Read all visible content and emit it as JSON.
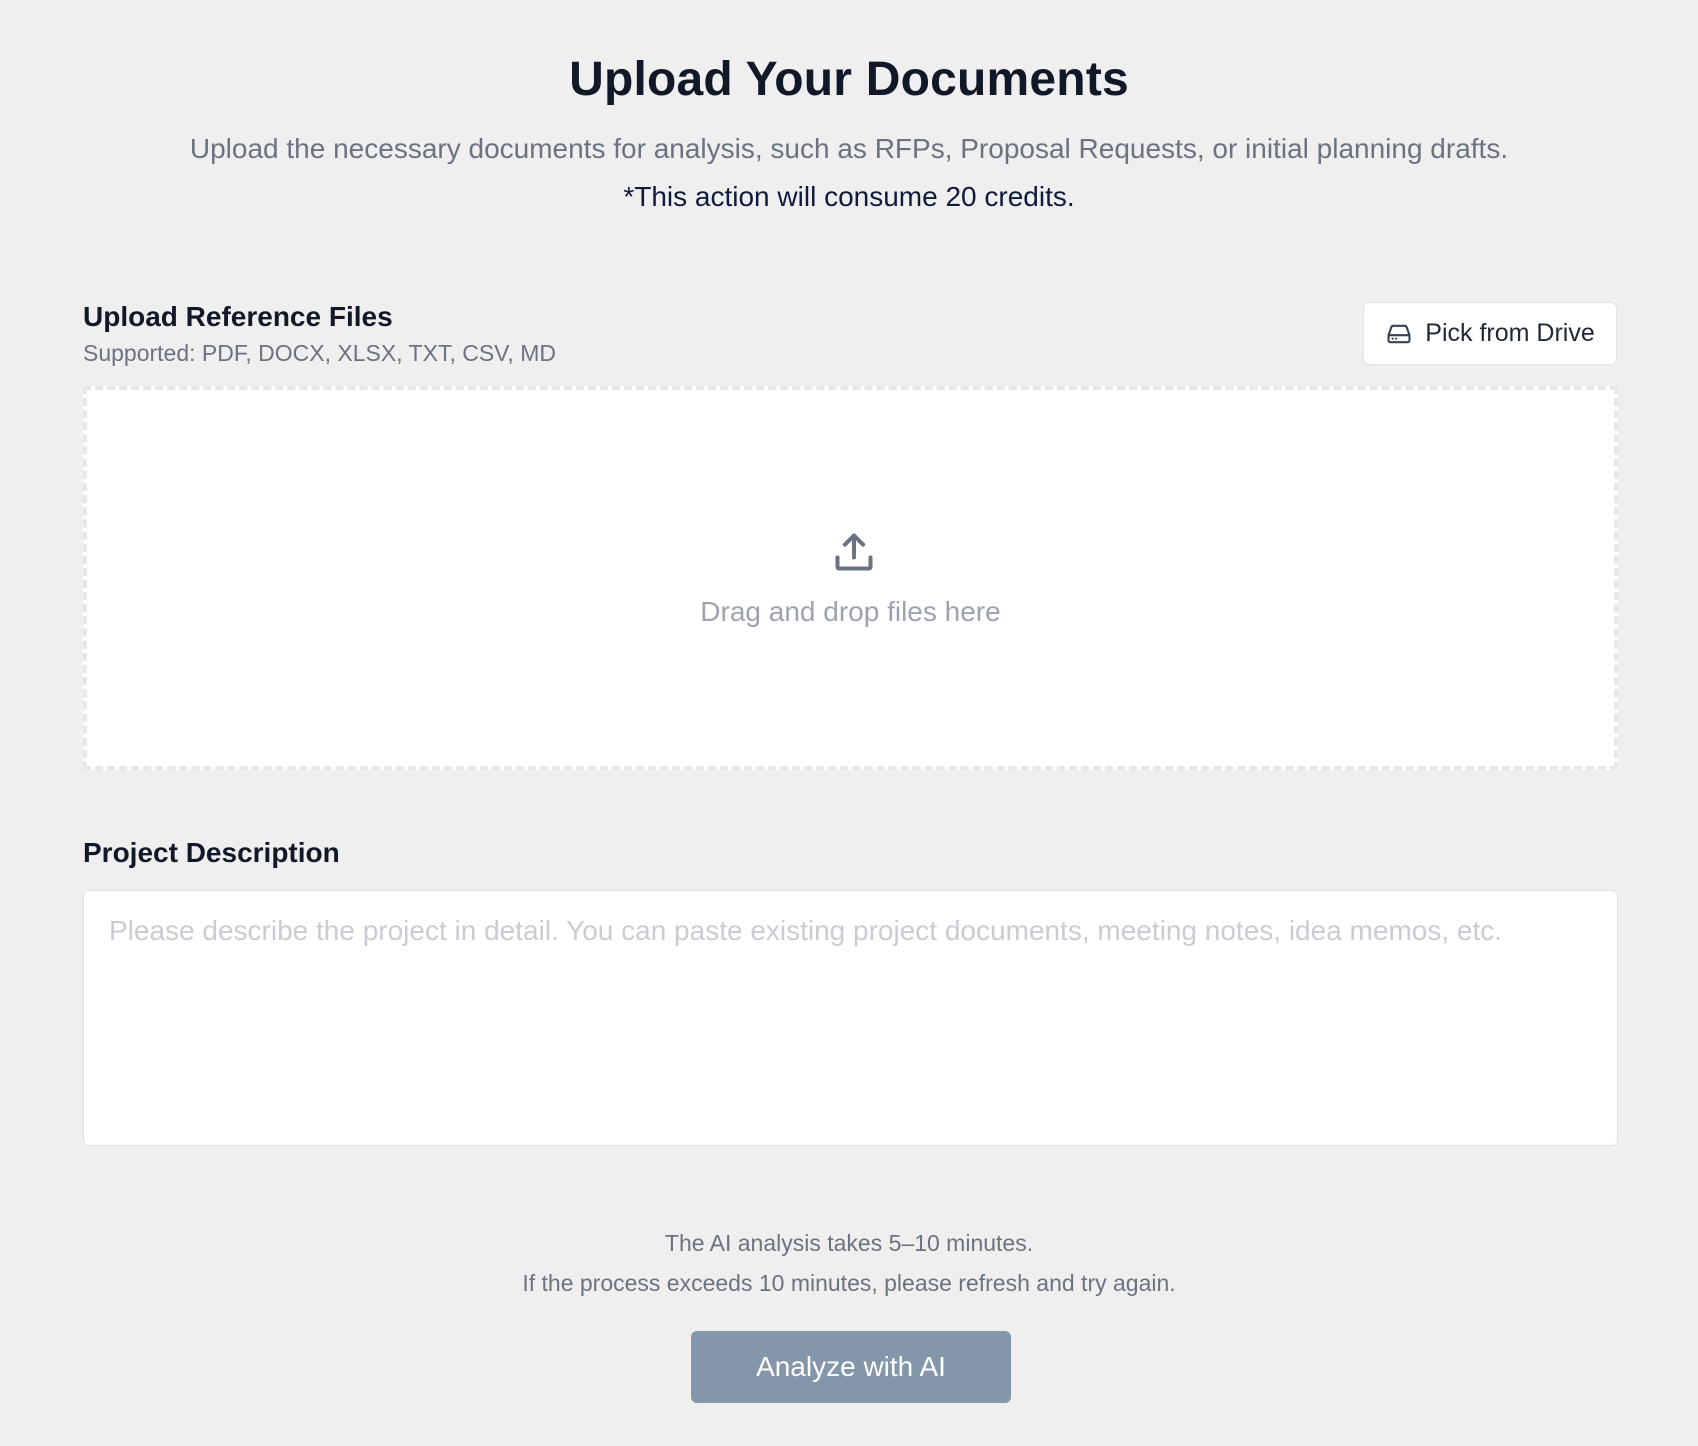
{
  "header": {
    "title": "Upload Your Documents",
    "subtitle": "Upload the necessary documents for analysis, such as RFPs, Proposal Requests, or initial planning drafts.",
    "credits_note": "*This action will consume 20 credits."
  },
  "upload": {
    "label": "Upload Reference Files",
    "supported": "Supported: PDF, DOCX, XLSX, TXT, CSV, MD",
    "drive_button_label": "Pick from Drive",
    "drive_icon": "hard-drive-icon",
    "dropzone_text": "Drag and drop files here",
    "dropzone_icon": "upload-icon"
  },
  "description": {
    "label": "Project Description",
    "value": "",
    "placeholder": "Please describe the project in detail. You can paste existing project documents, meeting notes, idea memos, etc."
  },
  "footer": {
    "note_line1": "The AI analysis takes 5–10 minutes.",
    "note_line2": "If the process exceeds 10 minutes, please refresh and try again.",
    "analyze_button_label": "Analyze with AI"
  },
  "colors": {
    "background": "#efefef",
    "title": "#111827",
    "muted_text": "#6b7280",
    "credits_text": "#0f1b3d",
    "button_disabled": "#8497aa",
    "placeholder": "#c9cdd3"
  }
}
